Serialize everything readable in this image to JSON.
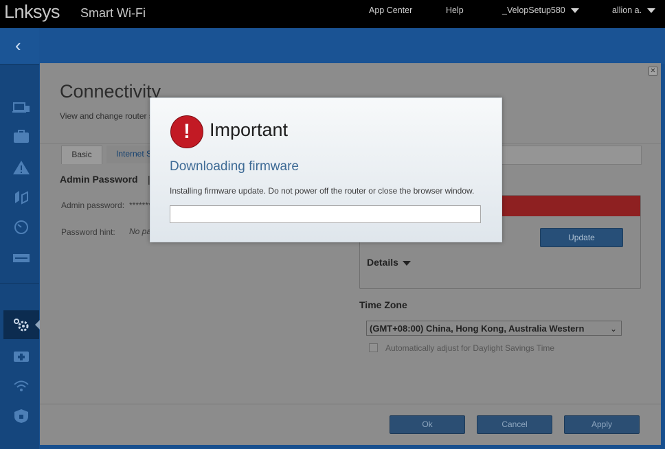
{
  "header": {
    "logo": "Lnksys",
    "product": "Smart Wi-Fi",
    "app_center": "App Center",
    "help": "Help",
    "network": "_VelopSetup580",
    "user": "allion a."
  },
  "panel": {
    "title": "Connectivity",
    "subtitle": "View and change router s",
    "tabs": [
      "Basic",
      "Internet S"
    ],
    "admin_title": "Admin Password",
    "admin_pipe": "|",
    "admin_password_label": "Admin password:",
    "admin_password_value": "*******",
    "password_hint_label": "Password hint:",
    "password_hint_value": "No pa",
    "update_label": "Update",
    "details_label": "Details",
    "timezone_title": "Time Zone",
    "timezone_value": "(GMT+08:00) China, Hong Kong, Australia Western",
    "dst_label": "Automatically adjust for Daylight Savings Time",
    "ok_label": "Ok",
    "cancel_label": "Cancel",
    "apply_label": "Apply"
  },
  "modal": {
    "icon": "exclamation-icon",
    "title": "Important",
    "subtitle": "Downloading firmware",
    "message": "Installing firmware update. Do not power off the router or close the browser window.",
    "progress": 0
  },
  "sidebar": {
    "icons": [
      "device-list-icon",
      "guest-access-icon",
      "parental-controls-icon",
      "media-prioritization-icon",
      "speed-test-icon",
      "external-storage-icon",
      "connectivity-settings-icon",
      "troubleshooting-icon",
      "wireless-icon",
      "security-icon"
    ]
  },
  "colors": {
    "header_bg": "#000000",
    "sidebar_bg": "#15467d",
    "panel_overlay": "#8c8c8c",
    "alert_red": "#c21a24",
    "subtitle_blue": "#3d6a95"
  }
}
